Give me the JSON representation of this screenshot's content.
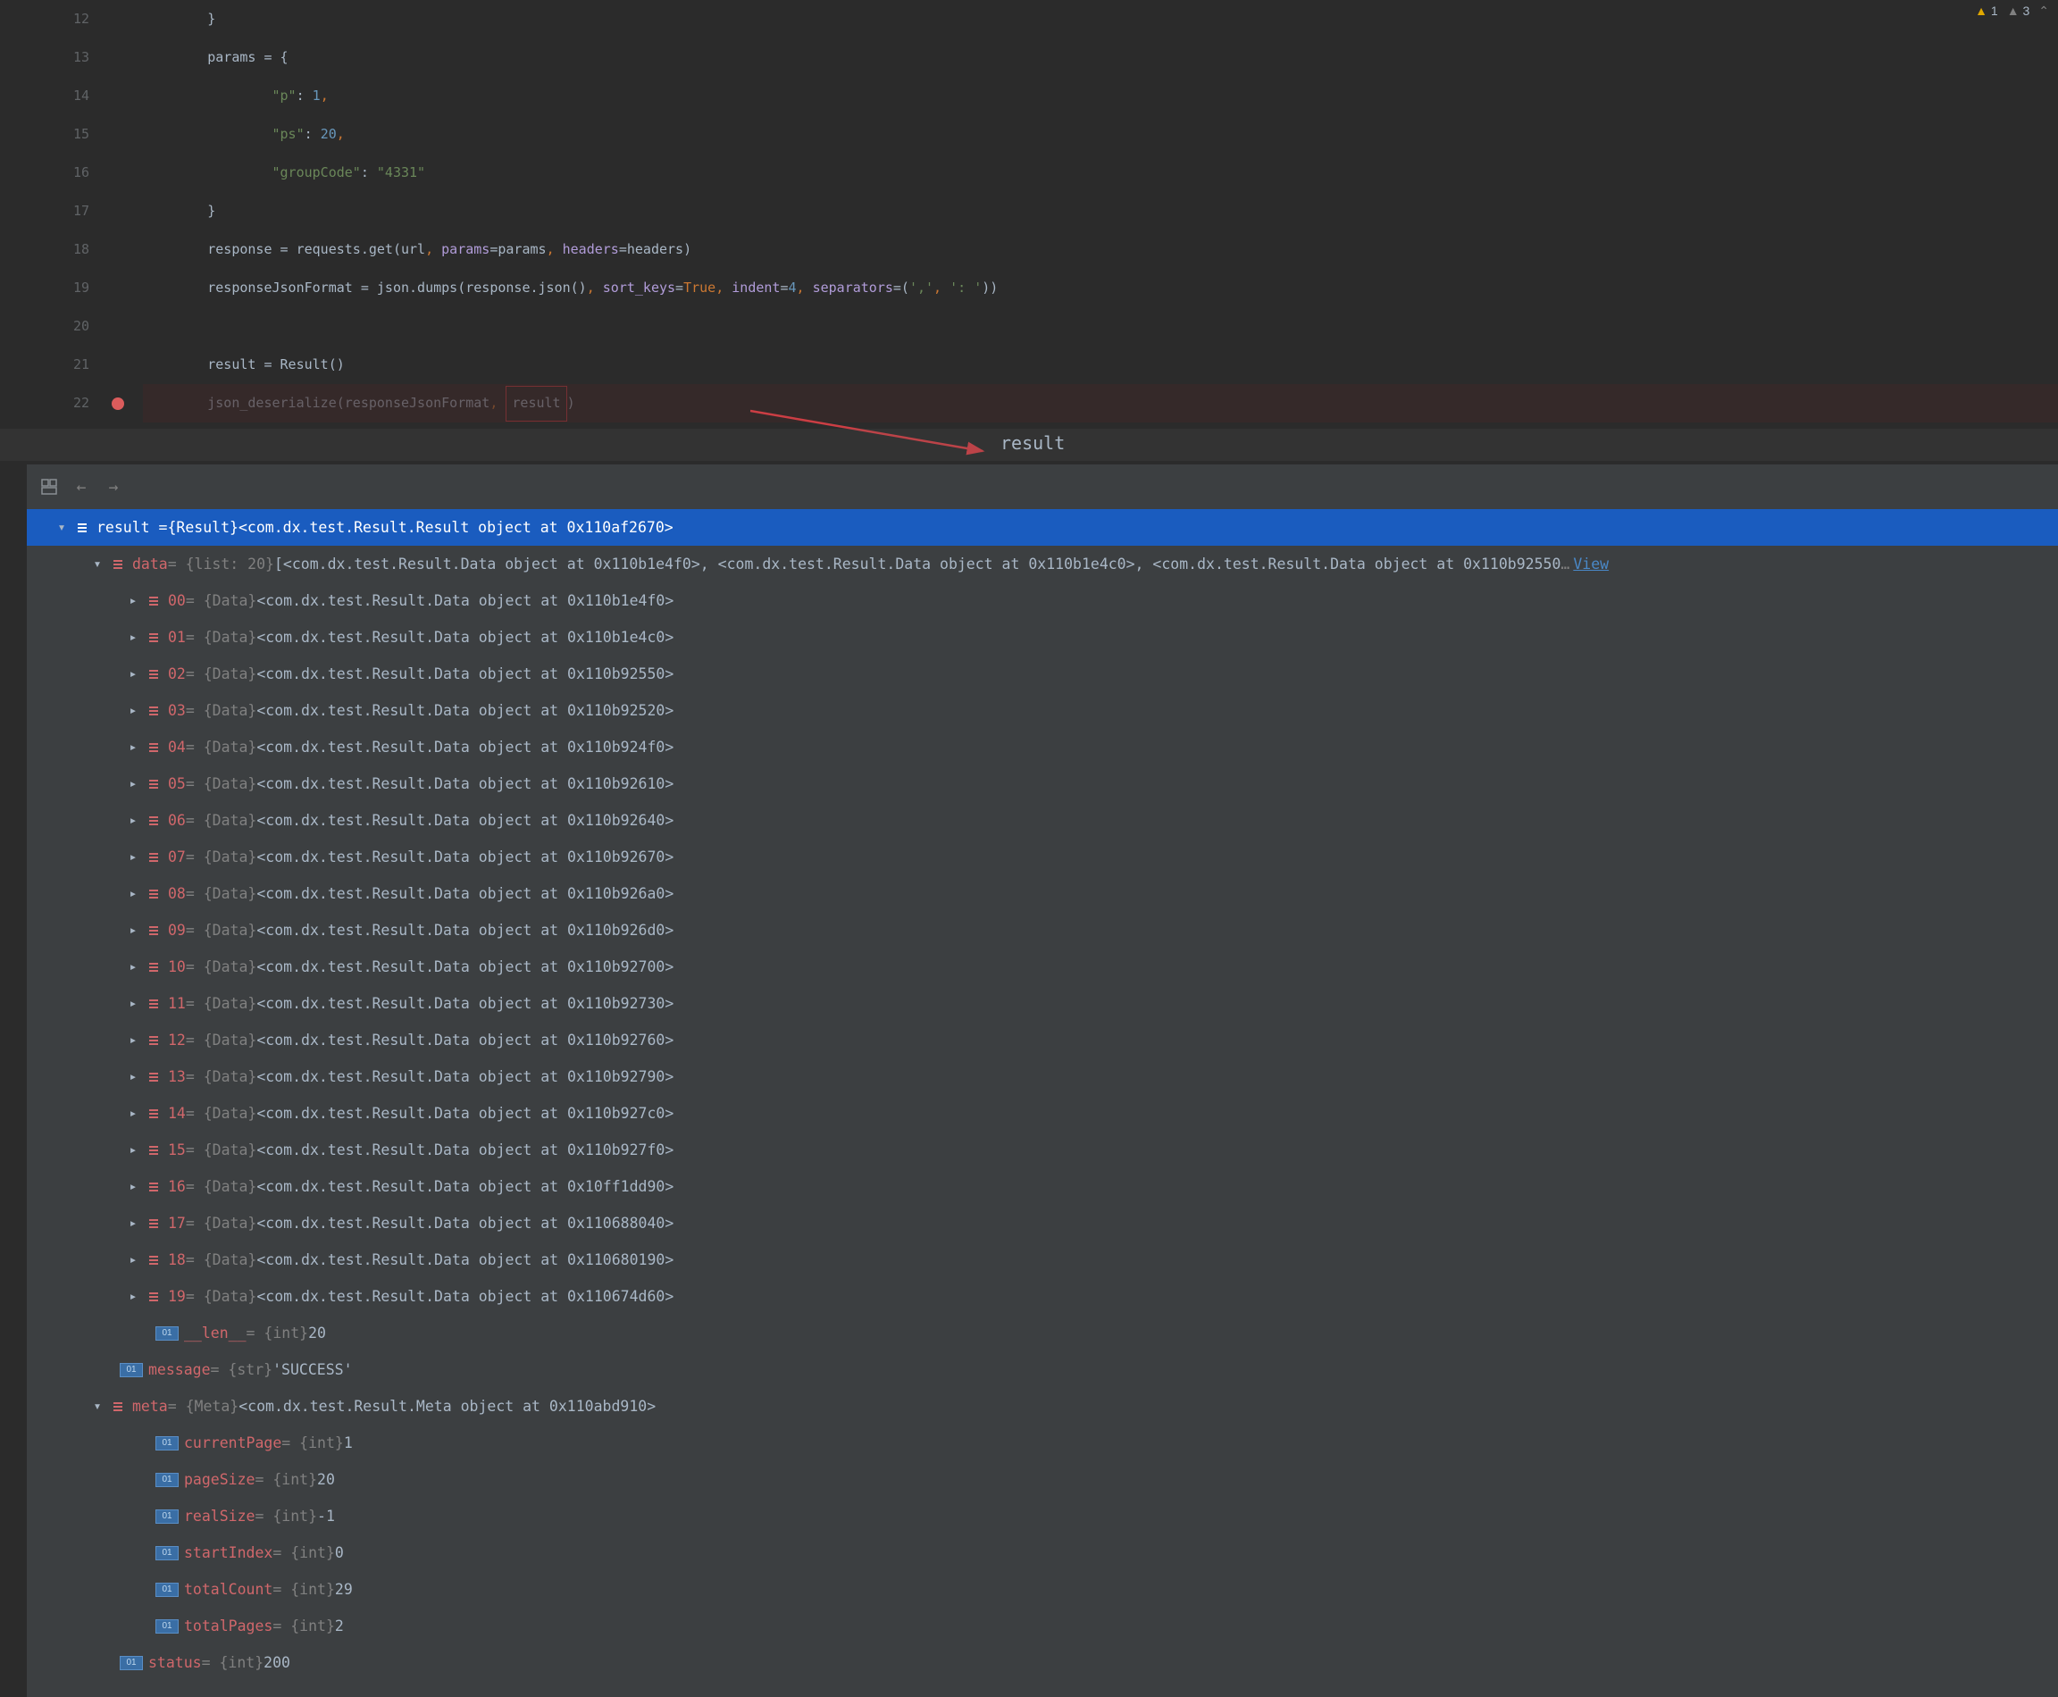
{
  "inspections": {
    "warn": "1",
    "weak": "3"
  },
  "code": {
    "lines": [
      {
        "n": "12",
        "ind": 2,
        "tokens": [
          {
            "t": "}",
            "c": "text-default"
          }
        ]
      },
      {
        "n": "13",
        "ind": 2,
        "tokens": [
          {
            "t": "params = {",
            "c": "text-default"
          }
        ]
      },
      {
        "n": "14",
        "ind": 4,
        "tokens": [
          {
            "t": "\"p\"",
            "c": "text-string"
          },
          {
            "t": ": ",
            "c": "text-default"
          },
          {
            "t": "1",
            "c": "text-num"
          },
          {
            "t": ",",
            "c": "text-orange"
          }
        ]
      },
      {
        "n": "15",
        "ind": 4,
        "tokens": [
          {
            "t": "\"ps\"",
            "c": "text-string"
          },
          {
            "t": ": ",
            "c": "text-default"
          },
          {
            "t": "20",
            "c": "text-num"
          },
          {
            "t": ",",
            "c": "text-orange"
          }
        ]
      },
      {
        "n": "16",
        "ind": 4,
        "tokens": [
          {
            "t": "\"groupCode\"",
            "c": "text-string"
          },
          {
            "t": ": ",
            "c": "text-default"
          },
          {
            "t": "\"4331\"",
            "c": "text-string"
          }
        ]
      },
      {
        "n": "17",
        "ind": 2,
        "tokens": [
          {
            "t": "}",
            "c": "text-default"
          }
        ]
      },
      {
        "n": "18",
        "ind": 2,
        "tokens": [
          {
            "t": "response = requests.get(url",
            "c": "text-default"
          },
          {
            "t": ", ",
            "c": "text-orange"
          },
          {
            "t": "params",
            "c": "text-purple"
          },
          {
            "t": "=params",
            "c": "text-default"
          },
          {
            "t": ", ",
            "c": "text-orange"
          },
          {
            "t": "headers",
            "c": "text-purple"
          },
          {
            "t": "=headers)",
            "c": "text-default"
          }
        ]
      },
      {
        "n": "19",
        "ind": 2,
        "tokens": [
          {
            "t": "responseJsonFormat = json.dumps(response.json()",
            "c": "text-default"
          },
          {
            "t": ", ",
            "c": "text-orange"
          },
          {
            "t": "sort_keys",
            "c": "text-purple"
          },
          {
            "t": "=",
            "c": "text-default"
          },
          {
            "t": "True",
            "c": "text-orange"
          },
          {
            "t": ", ",
            "c": "text-orange"
          },
          {
            "t": "indent",
            "c": "text-purple"
          },
          {
            "t": "=",
            "c": "text-default"
          },
          {
            "t": "4",
            "c": "text-num"
          },
          {
            "t": ", ",
            "c": "text-orange"
          },
          {
            "t": "separators",
            "c": "text-purple"
          },
          {
            "t": "=(",
            "c": "text-default"
          },
          {
            "t": "','",
            "c": "text-string"
          },
          {
            "t": ", ",
            "c": "text-orange"
          },
          {
            "t": "': '",
            "c": "text-string"
          },
          {
            "t": "))",
            "c": "text-default"
          }
        ]
      },
      {
        "n": "20",
        "ind": 2,
        "tokens": []
      },
      {
        "n": "21",
        "ind": 2,
        "tokens": [
          {
            "t": "result = Result()",
            "c": "text-default"
          }
        ]
      },
      {
        "n": "22",
        "ind": 2,
        "bp": true,
        "hl": true,
        "tokens": [
          {
            "t": "json_deserialize(responseJsonFormat",
            "c": "text-default"
          },
          {
            "t": ", ",
            "c": "text-orange"
          },
          {
            "box": true,
            "inner": [
              {
                "t": "result",
                "c": "text-default"
              }
            ]
          },
          {
            "t": ")",
            "c": "text-default"
          }
        ]
      }
    ]
  },
  "annotation_label": "result",
  "debug": {
    "root": {
      "name": "result",
      "type": "{Result}",
      "value": "<com.dx.test.Result.Result object at 0x110af2670>"
    },
    "data_header": {
      "name": "data",
      "type": "{list: 20}",
      "preview": "[<com.dx.test.Result.Data object at 0x110b1e4f0>, <com.dx.test.Result.Data object at 0x110b1e4c0>, <com.dx.test.Result.Data object at 0x110b92550",
      "view": "View"
    },
    "data_items": [
      {
        "idx": "00",
        "addr": "0x110b1e4f0"
      },
      {
        "idx": "01",
        "addr": "0x110b1e4c0"
      },
      {
        "idx": "02",
        "addr": "0x110b92550"
      },
      {
        "idx": "03",
        "addr": "0x110b92520"
      },
      {
        "idx": "04",
        "addr": "0x110b924f0"
      },
      {
        "idx": "05",
        "addr": "0x110b92610"
      },
      {
        "idx": "06",
        "addr": "0x110b92640"
      },
      {
        "idx": "07",
        "addr": "0x110b92670"
      },
      {
        "idx": "08",
        "addr": "0x110b926a0"
      },
      {
        "idx": "09",
        "addr": "0x110b926d0"
      },
      {
        "idx": "10",
        "addr": "0x110b92700"
      },
      {
        "idx": "11",
        "addr": "0x110b92730"
      },
      {
        "idx": "12",
        "addr": "0x110b92760"
      },
      {
        "idx": "13",
        "addr": "0x110b92790"
      },
      {
        "idx": "14",
        "addr": "0x110b927c0"
      },
      {
        "idx": "15",
        "addr": "0x110b927f0"
      },
      {
        "idx": "16",
        "addr": "0x10ff1dd90"
      },
      {
        "idx": "17",
        "addr": "0x110688040"
      },
      {
        "idx": "18",
        "addr": "0x110680190"
      },
      {
        "idx": "19",
        "addr": "0x110674d60"
      }
    ],
    "data_item_label": "{Data} <com.dx.test.Result.Data object at ",
    "len_row": {
      "name": "__len__",
      "type": "{int}",
      "value": "20"
    },
    "message": {
      "name": "message",
      "type": "{str}",
      "value": "'SUCCESS'"
    },
    "meta_header": {
      "name": "meta",
      "type": "{Meta}",
      "value": "<com.dx.test.Result.Meta object at 0x110abd910>"
    },
    "meta_items": [
      {
        "name": "currentPage",
        "type": "{int}",
        "value": "1"
      },
      {
        "name": "pageSize",
        "type": "{int}",
        "value": "20"
      },
      {
        "name": "realSize",
        "type": "{int}",
        "value": "-1"
      },
      {
        "name": "startIndex",
        "type": "{int}",
        "value": "0"
      },
      {
        "name": "totalCount",
        "type": "{int}",
        "value": "29"
      },
      {
        "name": "totalPages",
        "type": "{int}",
        "value": "2"
      }
    ],
    "status": {
      "name": "status",
      "type": "{int}",
      "value": "200"
    }
  }
}
